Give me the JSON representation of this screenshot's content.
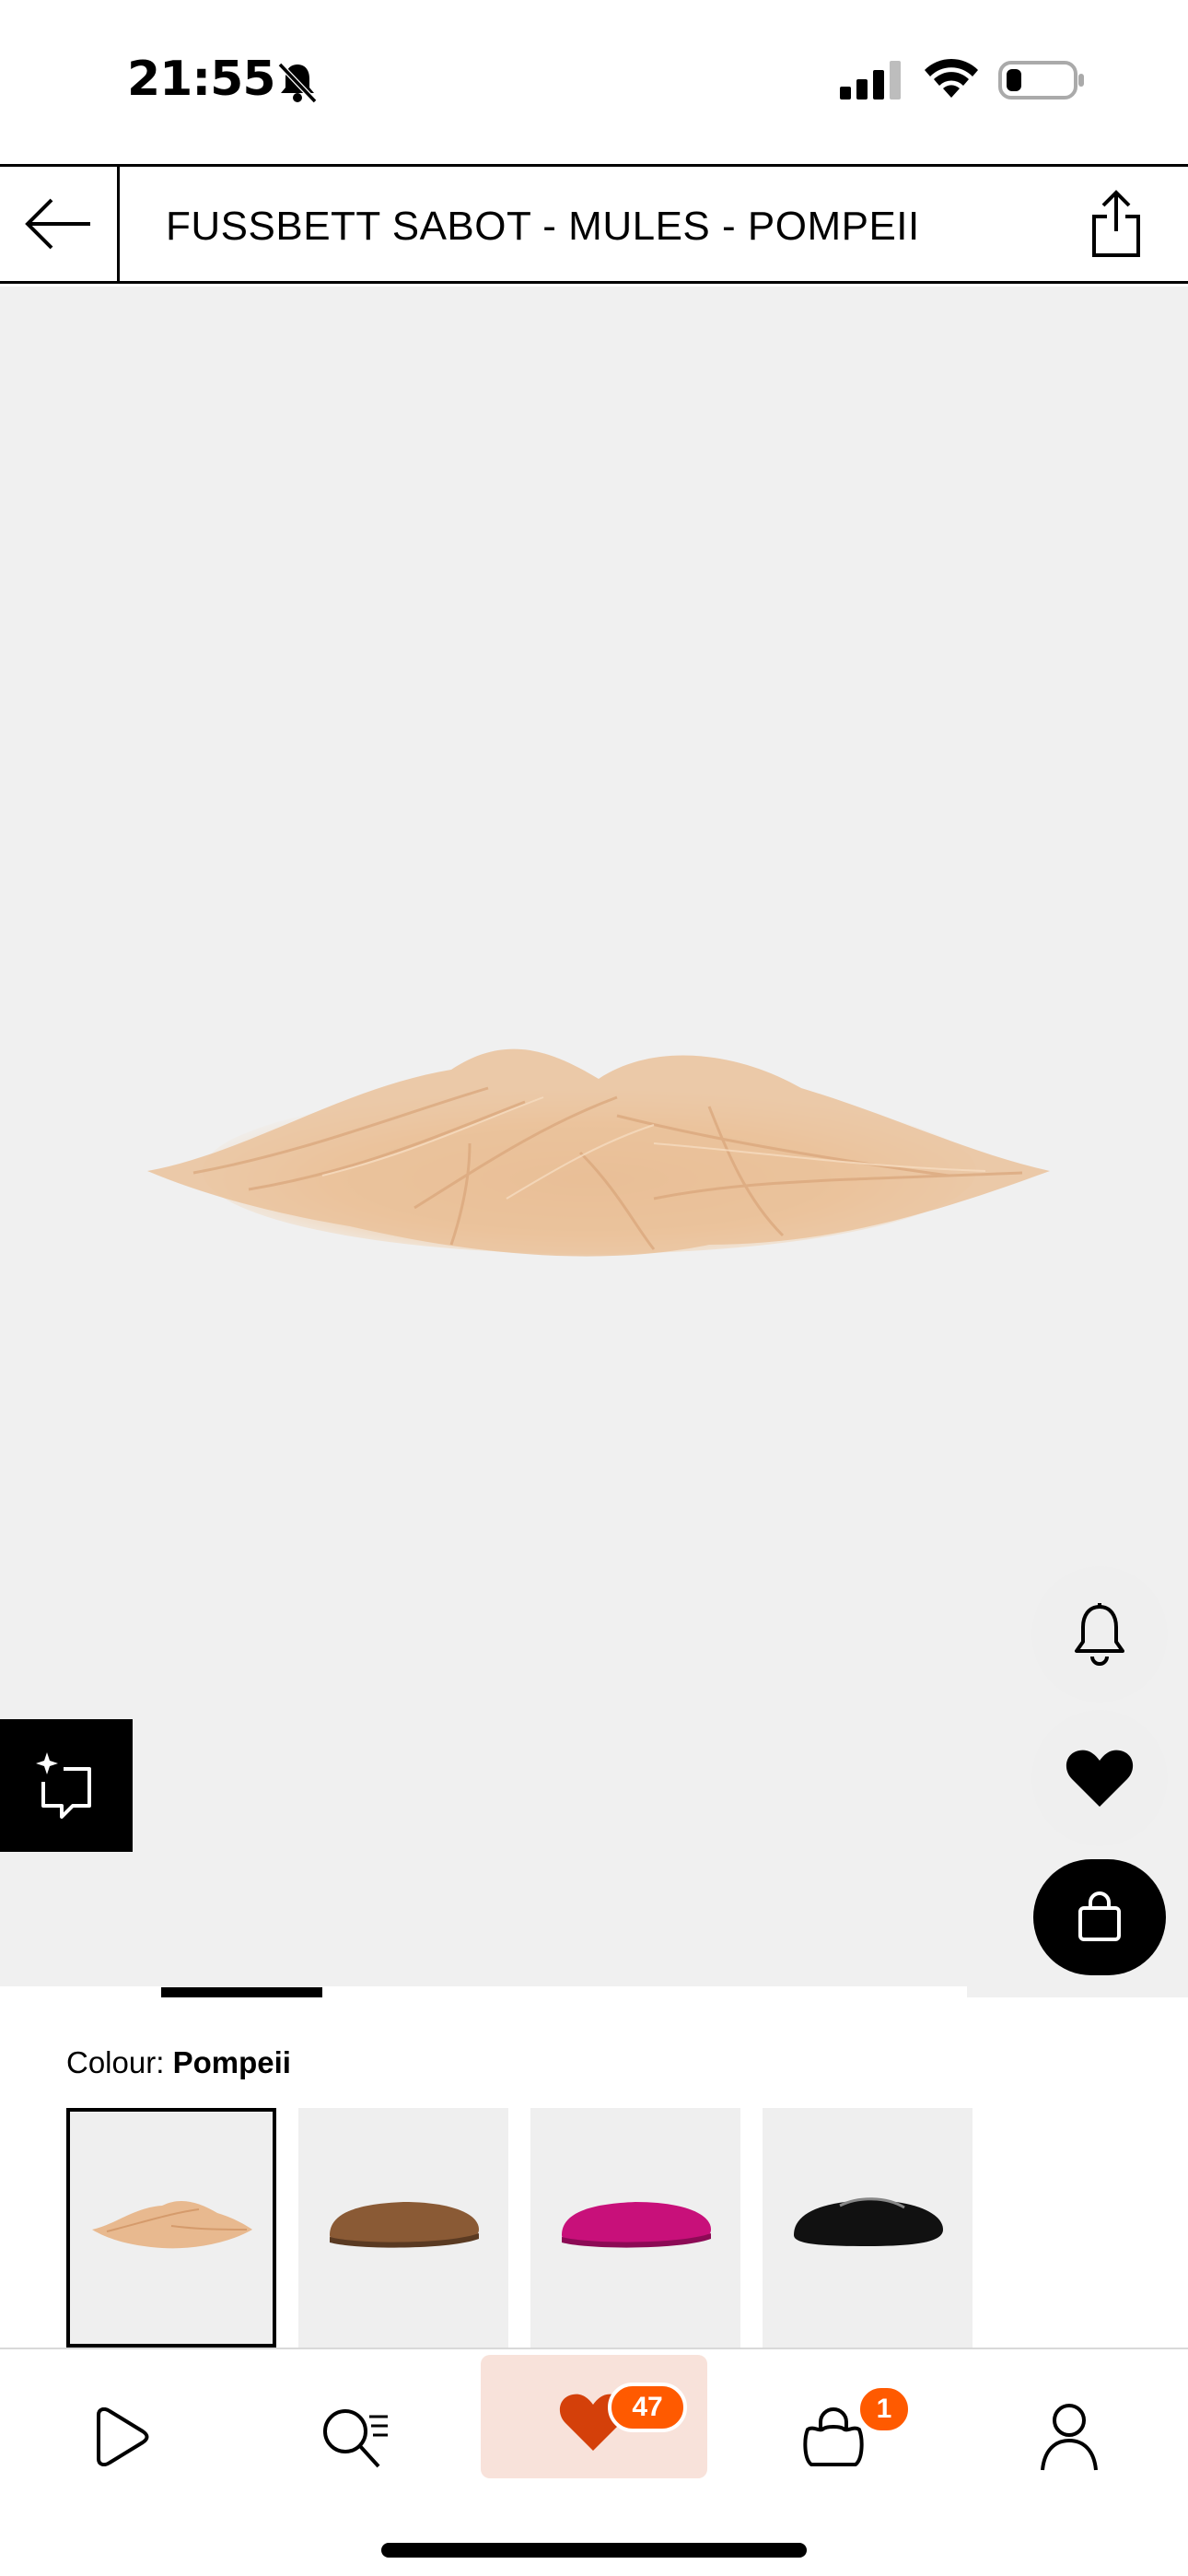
{
  "status_bar": {
    "time": "21:55",
    "icons": [
      "bell-slash-icon",
      "cellular-signal-icon",
      "wifi-icon",
      "battery-icon"
    ]
  },
  "header": {
    "title": "FUSSBETT SABOT - MULES - POMPEII",
    "back_icon": "arrow-left-icon",
    "share_icon": "share-icon"
  },
  "hero": {
    "image_icon": "fur-mule-product-image",
    "actions": [
      "bell-icon",
      "heart-icon",
      "shopping-bag-icon",
      "ai-sparkle-icon"
    ]
  },
  "carousel": {
    "progress": 0.1667
  },
  "colour": {
    "label": "Colour:",
    "selected": "Pompeii",
    "swatches": [
      {
        "name": "Pompeii",
        "color": "#e8b98f",
        "selected": true
      },
      {
        "name": "Brown",
        "color": "#8a5a35",
        "selected": false
      },
      {
        "name": "Magenta",
        "color": "#c8107a",
        "selected": false
      },
      {
        "name": "Black",
        "color": "#111111",
        "selected": false
      }
    ]
  },
  "bottom_nav": {
    "items": [
      {
        "icon": "play-icon"
      },
      {
        "icon": "search-icon"
      },
      {
        "icon": "heart-icon",
        "badge": "47",
        "active": true
      },
      {
        "icon": "bag-icon",
        "badge": "1"
      },
      {
        "icon": "user-icon"
      }
    ]
  },
  "colors": {
    "accent": "#ff5a00",
    "active_tab_bg": "#f8e2da",
    "hero_bg": "#f0f0f0"
  }
}
